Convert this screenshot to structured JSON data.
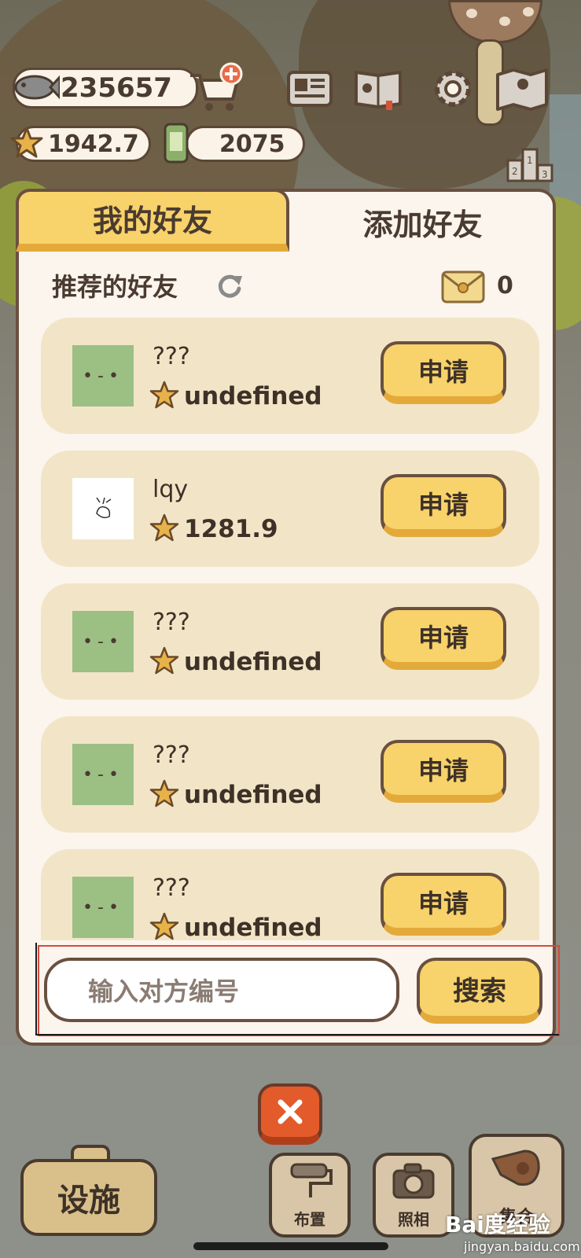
{
  "hud": {
    "fish_count": "235657",
    "star_score": "1942.7",
    "can_count": "2075"
  },
  "tabs": {
    "my_friends": "我的好友",
    "add_friends": "添加好友"
  },
  "recommended": {
    "title": "推荐的好友",
    "mail_count": "0",
    "items": [
      {
        "name": "???",
        "score": "undefined",
        "avatar": "green-face"
      },
      {
        "name": "lqy",
        "score": "1281.9",
        "avatar": "white-sketch"
      },
      {
        "name": "???",
        "score": "undefined",
        "avatar": "green-face"
      },
      {
        "name": "???",
        "score": "undefined",
        "avatar": "green-face"
      },
      {
        "name": "???",
        "score": "undefined",
        "avatar": "green-face"
      }
    ],
    "apply_label": "申请"
  },
  "search": {
    "placeholder": "输入对方编号",
    "button_label": "搜索"
  },
  "bottom": {
    "facility": "设施",
    "layout": "布置",
    "photo": "照相",
    "gather": "集合"
  },
  "watermark": {
    "brand": "Bai度经验",
    "url": "jingyan.baidu.com"
  },
  "colors": {
    "accent_yellow": "#f8d26a",
    "border_brown": "#6a5040",
    "panel_bg": "#fcf5ee",
    "card_bg": "#f2e5c7",
    "close_orange": "#e35b2a"
  }
}
